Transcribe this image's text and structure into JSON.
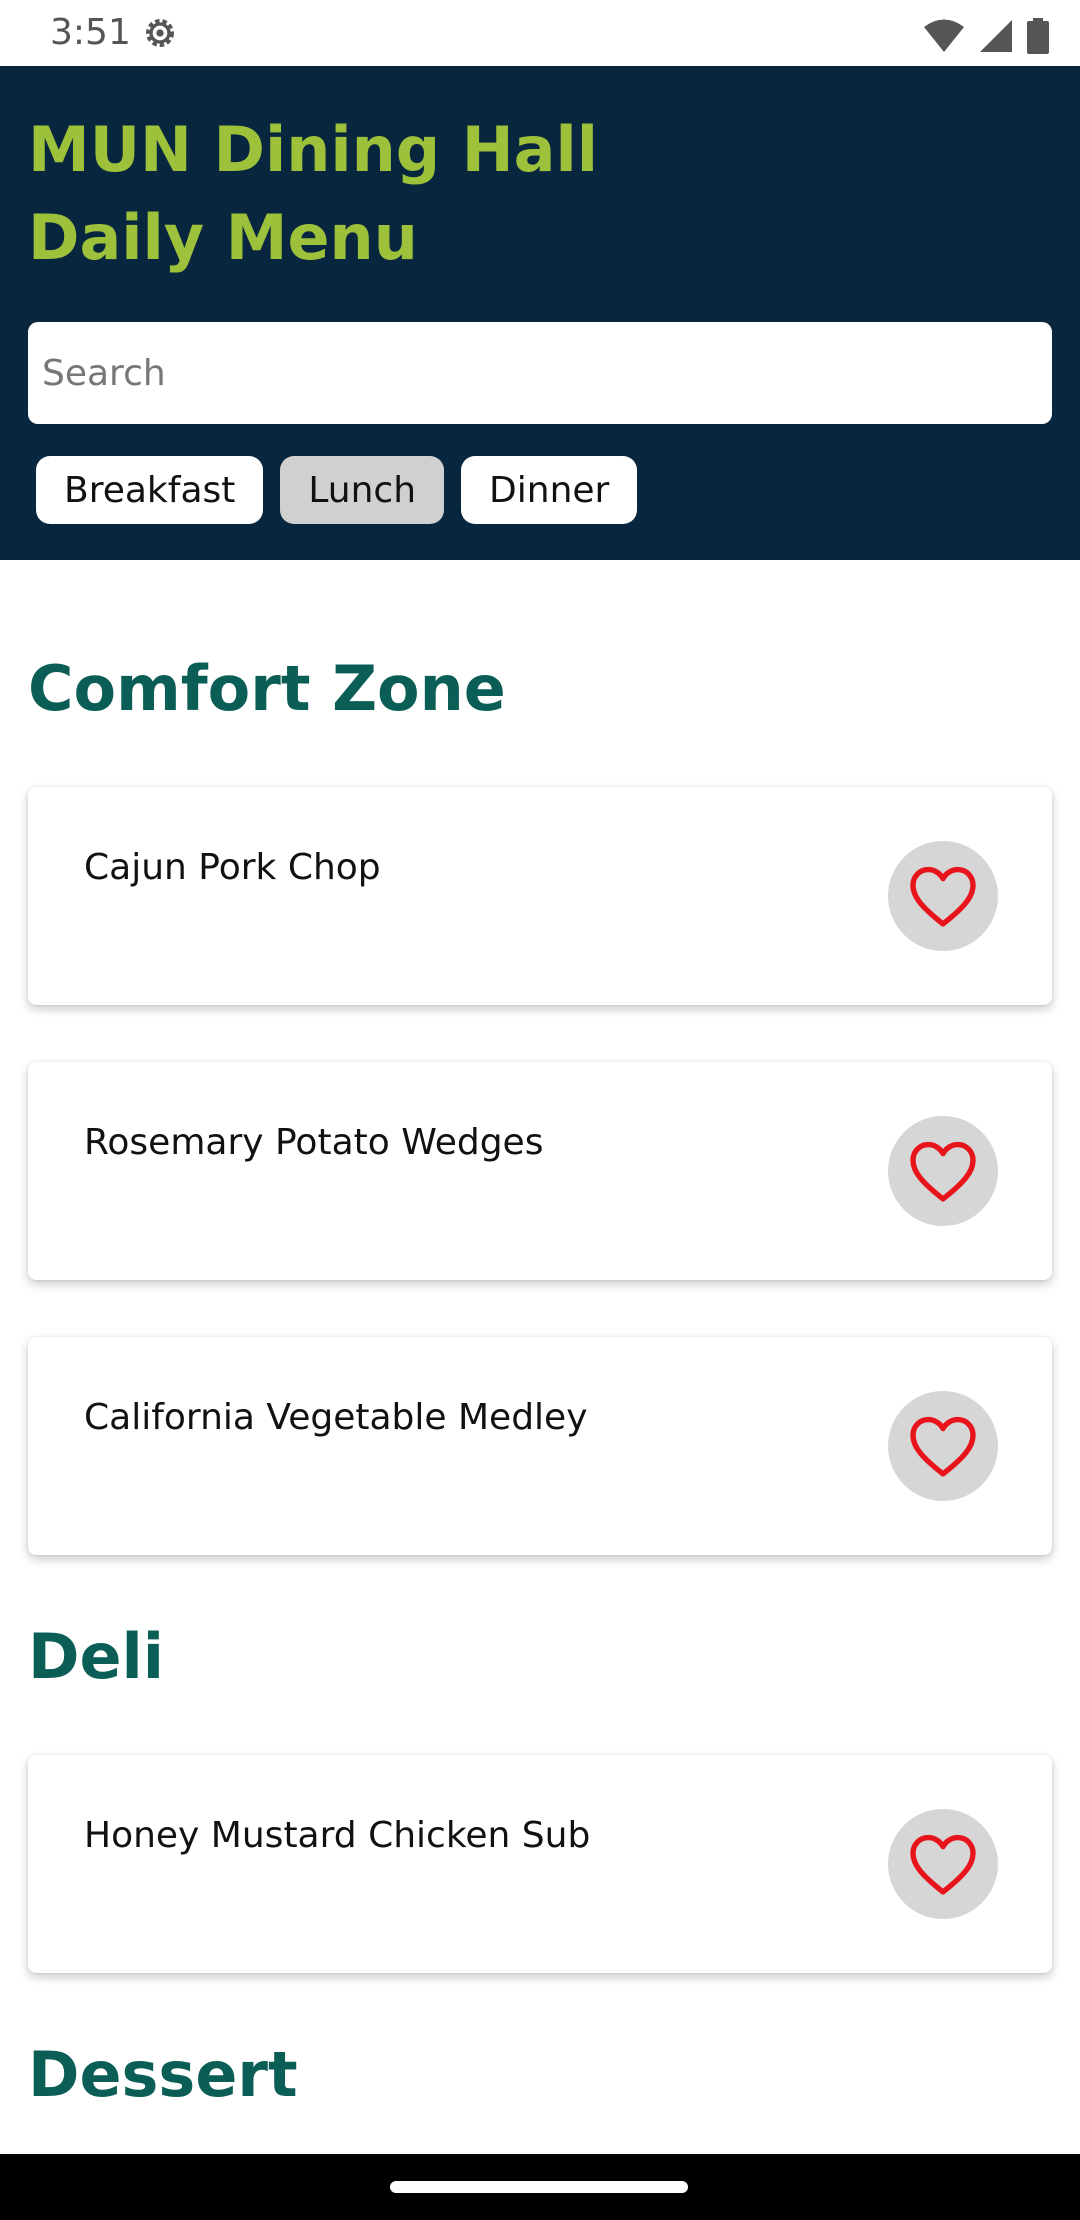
{
  "status_bar": {
    "time": "3:51",
    "icons": [
      "settings-gear-icon",
      "wifi-icon",
      "cellular-signal-icon",
      "battery-icon"
    ]
  },
  "header": {
    "title": "MUN Dining Hall Daily Menu",
    "background_color": "#08273e",
    "title_color": "#9dc13b"
  },
  "search": {
    "placeholder": "Search",
    "value": ""
  },
  "meal_tabs": [
    {
      "label": "Breakfast",
      "selected": false
    },
    {
      "label": "Lunch",
      "selected": true
    },
    {
      "label": "Dinner",
      "selected": false
    }
  ],
  "sections": [
    {
      "title": "Comfort Zone",
      "items": [
        {
          "name": "Cajun Pork Chop",
          "icon": "heart-outline-icon"
        },
        {
          "name": "Rosemary Potato Wedges",
          "icon": "heart-outline-icon"
        },
        {
          "name": "California Vegetable Medley",
          "icon": "heart-outline-icon"
        }
      ]
    },
    {
      "title": "Deli",
      "items": [
        {
          "name": "Honey Mustard Chicken Sub",
          "icon": "heart-outline-icon"
        }
      ]
    },
    {
      "title": "Dessert",
      "items": []
    }
  ],
  "colors": {
    "section_heading": "#0b5e56",
    "heart": "#e8141b",
    "favorite_button_bg": "#d6d6d6",
    "selected_tab_bg": "#d0d0d0"
  }
}
